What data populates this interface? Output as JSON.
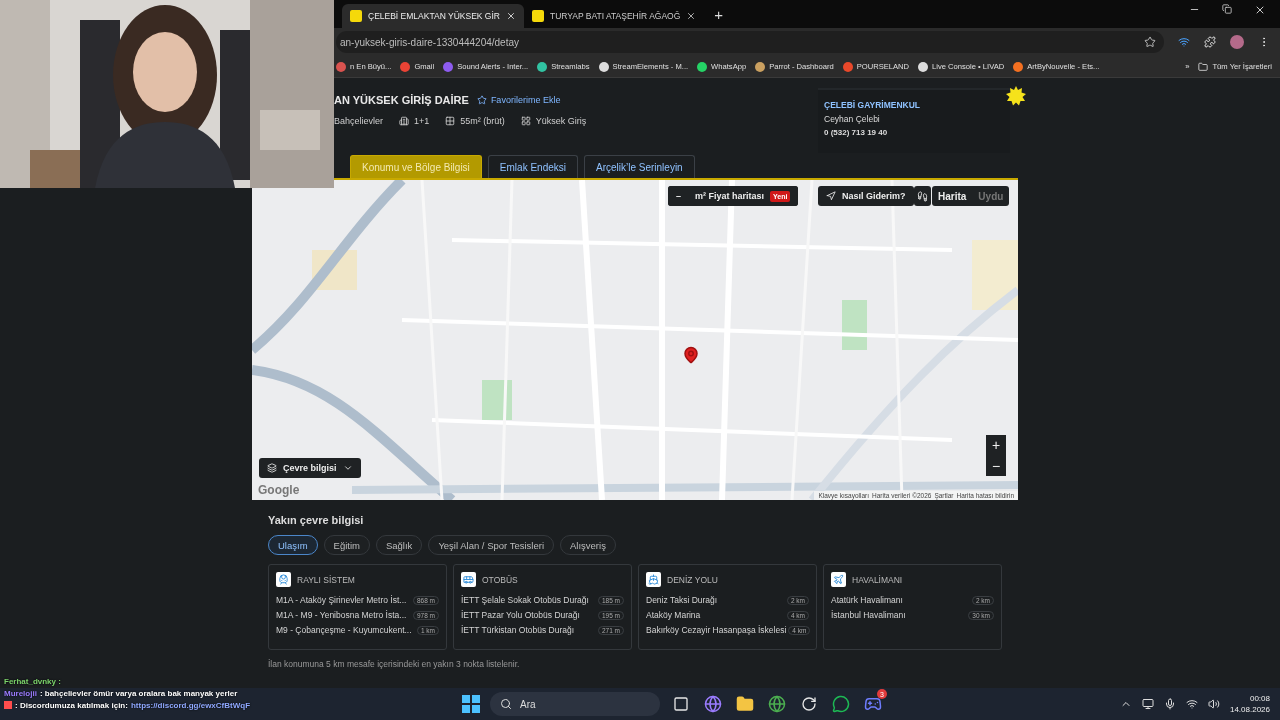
{
  "browser": {
    "tabs": [
      {
        "title": "ÇELEBİ EMLAKTAN YÜKSEK GİR",
        "selected": true
      },
      {
        "title": "TURYAP BATI ATAŞEHİR AĞAOĞ",
        "selected": false
      }
    ],
    "new_tab": "+",
    "url": "an-yuksek-giris-daire-1330444204/detay",
    "bookmarks": [
      {
        "kind": "site",
        "label": "n En Büyü..."
      },
      {
        "kind": "mail",
        "label": "Gmail"
      },
      {
        "kind": "sound",
        "label": "Sound Alerts - Inter..."
      },
      {
        "kind": "stream",
        "label": "Streamlabs"
      },
      {
        "kind": "elements",
        "label": "StreamElements - M..."
      },
      {
        "kind": "chat",
        "label": "WhatsApp"
      },
      {
        "kind": "bird",
        "label": "Parrot - Dashboard"
      },
      {
        "kind": "game",
        "label": "POURSELAND"
      },
      {
        "kind": "console",
        "label": "Live Console • LIVAD"
      },
      {
        "kind": "shop",
        "label": "ArtByNouvelle - Ets..."
      }
    ],
    "more": "»",
    "all_bookmarks": "Tüm Yer İşaretleri"
  },
  "listing": {
    "title": "AN YÜKSEK GİRİŞ DAİRE",
    "favorite": "Favorilerime Ekle",
    "features": [
      {
        "kind": "location",
        "text": "Bahçelievler"
      },
      {
        "kind": "rooms",
        "text": "1+1"
      },
      {
        "kind": "area",
        "text": "55m² (brüt)"
      },
      {
        "kind": "floor",
        "text": "Yüksek Giriş"
      }
    ],
    "agent": {
      "company": "ÇELEBİ GAYRİMENKUL",
      "name": "Ceyhan Çelebi",
      "phone": "0 (532) 713 19 40"
    }
  },
  "page_tabs": [
    {
      "label": "Konumu ve Bölge Bilgisi",
      "selected": true
    },
    {
      "label": "Emlak Endeksi",
      "selected": false
    },
    {
      "label": "Arçelik’le Serinleyin",
      "selected": false
    }
  ],
  "map": {
    "price_map": {
      "minus": "–",
      "label": "m² Fiyat haritası",
      "badge": "Yeni"
    },
    "directions": "Nasıl Giderim?",
    "map_types": [
      {
        "label": "Harita",
        "selected": true
      },
      {
        "label": "Uydu",
        "selected": false
      }
    ],
    "zoom_in": "+",
    "zoom_out": "−",
    "surroundings": "Çevre bilgisi",
    "logo": "Google",
    "footer_links": [
      "Klavye kısayolları",
      "Harita verileri ©2026",
      "Şartlar",
      "Harita hatası bildirin"
    ]
  },
  "nearby": {
    "title": "Yakın çevre bilgisi",
    "categories": [
      {
        "label": "Ulaşım",
        "selected": true
      },
      {
        "label": "Eğitim",
        "selected": false
      },
      {
        "label": "Sağlık",
        "selected": false
      },
      {
        "label": "Yeşil Alan / Spor Tesisleri",
        "selected": false
      },
      {
        "label": "Alışveriş",
        "selected": false
      }
    ],
    "groups": [
      {
        "kind": "rail",
        "title": "RAYLI SİSTEM",
        "places": [
          {
            "name": "M1A - Ataköy Şirinevler Metro İst...",
            "distance": "868 m"
          },
          {
            "name": "M1A - M9 - Yenibosna Metro İsta...",
            "distance": "978 m"
          },
          {
            "name": "M9 - Çobançeşme - Kuyumcukent...",
            "distance": "1 km"
          }
        ]
      },
      {
        "kind": "bus",
        "title": "OTOBÜS",
        "places": [
          {
            "name": "İETT Şelale Sokak Otobüs Durağı",
            "distance": "185 m"
          },
          {
            "name": "İETT Pazar Yolu Otobüs Durağı",
            "distance": "195 m"
          },
          {
            "name": "İETT Türkistan Otobüs Durağı",
            "distance": "271 m"
          }
        ]
      },
      {
        "kind": "ferry",
        "title": "DENİZ YOLU",
        "places": [
          {
            "name": "Deniz Taksi Durağı",
            "distance": "2 km"
          },
          {
            "name": "Ataköy Marina",
            "distance": "4 km"
          },
          {
            "name": "Bakırköy Cezayir Hasanpaşa İskelesi",
            "distance": "4 km"
          }
        ]
      },
      {
        "kind": "plane",
        "title": "HAVALİMANI",
        "places": [
          {
            "name": "Atatürk Havalimanı",
            "distance": "2 km"
          },
          {
            "name": "İstanbul Havalimanı",
            "distance": "30 km"
          }
        ]
      }
    ],
    "note": "İlan konumuna 5 km mesafe içerisindeki en yakın 3 nokta listelenir."
  },
  "chat": [
    {
      "user": "Ferhat_dvnky :",
      "color": "#7cd36b"
    },
    {
      "user": "Murelojii",
      "text": ": bahçelievler ömür varya oralara bak manyak yerler",
      "color": "#9b7cff"
    },
    {
      "text": ": Discordumuza katılmak için:",
      "link": "https://discord.gg/ewxCfBtWqF",
      "color": "#ff4d4d"
    }
  ],
  "taskbar": {
    "search": "Ara",
    "discord_badge": "3",
    "time": "00:08",
    "date": "14.08.2026"
  }
}
